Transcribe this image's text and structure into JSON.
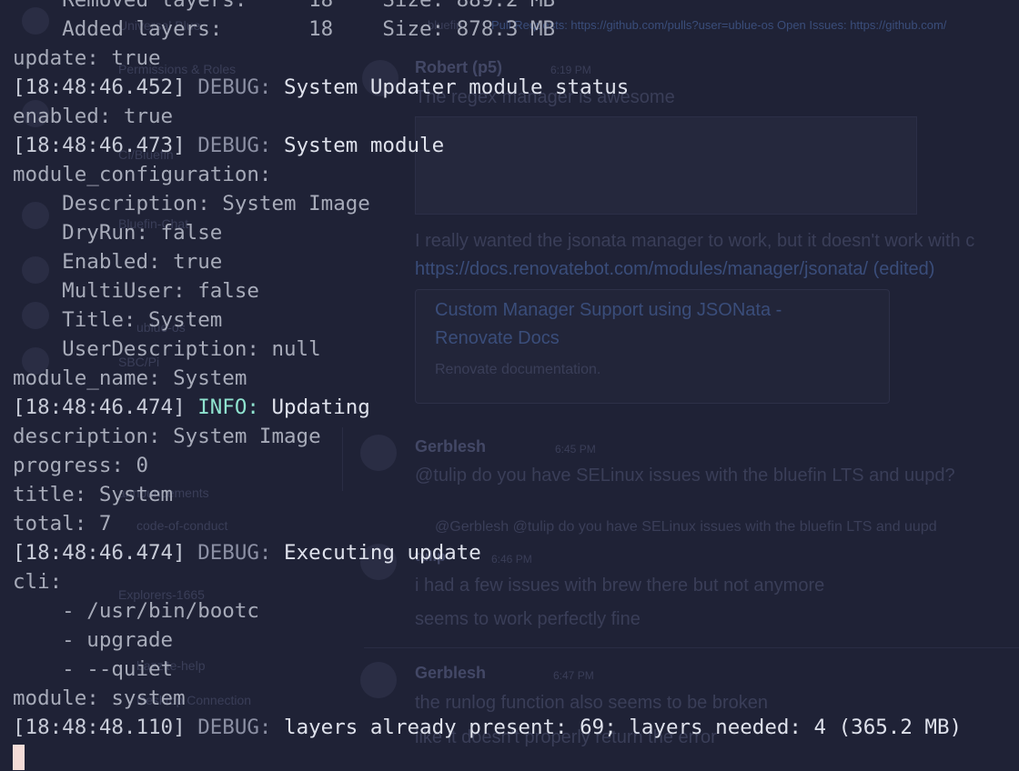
{
  "background_app": {
    "sidebar": {
      "items": [
        "Universal Blue",
        "Permissions & Roles",
        "CI/Bluefin",
        "Bluefin-Chat",
        "ublue-os",
        "SBC/Pi",
        "announcements",
        "code-of-conduct",
        "Explorers-1665",
        "bazzite-help",
        "Desktop Connection"
      ]
    },
    "header": {
      "channel": "bluefin",
      "links": "Pull Requests: https://github.com/pulls?user=ublue-os  Open Issues: https://github.com/"
    },
    "messages": [
      {
        "author": "Robert (p5)",
        "time": "6:19 PM",
        "text": "The regex manager is awesome"
      },
      {
        "author": "",
        "time": "",
        "text": "I really wanted the jsonata manager to work, but it doesn't work with c"
      },
      {
        "author": "",
        "time": "",
        "text": "https://docs.renovatebot.com/modules/manager/jsonata/ (edited)"
      },
      {
        "author": "Gerblesh",
        "time": "6:45 PM",
        "text": "@tulip do you have SELinux issues with the bluefin LTS and uupd?"
      },
      {
        "author": "",
        "time": "",
        "text": "@Gerblesh @tulip do you have SELinux issues with the bluefin LTS and uupd"
      },
      {
        "author": "tulip",
        "time": "6:46 PM",
        "text": "i had a few issues with brew there but not anymore"
      },
      {
        "author": "",
        "time": "",
        "text": "seems to work perfectly fine"
      },
      {
        "author": "Gerblesh",
        "time": "6:47 PM",
        "text": "the runlog function also seems to be broken"
      },
      {
        "author": "",
        "time": "",
        "text": "like it doesn't properly return the error"
      }
    ],
    "embed": {
      "title_line1": "Custom Manager Support using JSONata -",
      "title_line2": "Renovate Docs",
      "description": "Renovate documentation."
    }
  },
  "terminal": {
    "lines": [
      {
        "kind": "plain",
        "text": "    Removed layers:     18    Size: 889.2 MB"
      },
      {
        "kind": "plain",
        "text": "    Added layers:       18    Size: 878.3 MB"
      },
      {
        "kind": "plain",
        "text": "update: true"
      },
      {
        "kind": "log",
        "ts": "[18:48:46.452]",
        "level": "DEBUG:",
        "levelClass": "debug",
        "msg": "System Updater module status"
      },
      {
        "kind": "plain",
        "text": "enabled: true"
      },
      {
        "kind": "log",
        "ts": "[18:48:46.473]",
        "level": "DEBUG:",
        "levelClass": "debug",
        "msg": "System module"
      },
      {
        "kind": "plain",
        "text": "module_configuration:"
      },
      {
        "kind": "plain",
        "text": "    Description: System Image"
      },
      {
        "kind": "plain",
        "text": "    DryRun: false"
      },
      {
        "kind": "plain",
        "text": "    Enabled: true"
      },
      {
        "kind": "plain",
        "text": "    MultiUser: false"
      },
      {
        "kind": "plain",
        "text": "    Title: System"
      },
      {
        "kind": "plain",
        "text": "    UserDescription: null"
      },
      {
        "kind": "plain",
        "text": "module_name: System"
      },
      {
        "kind": "log",
        "ts": "[18:48:46.474]",
        "level": "INFO:",
        "levelClass": "info",
        "msg": "Updating"
      },
      {
        "kind": "plain",
        "text": "description: System Image"
      },
      {
        "kind": "plain",
        "text": "progress: 0"
      },
      {
        "kind": "plain",
        "text": "title: System"
      },
      {
        "kind": "plain",
        "text": "total: 7"
      },
      {
        "kind": "log",
        "ts": "[18:48:46.474]",
        "level": "DEBUG:",
        "levelClass": "debug",
        "msg": "Executing update"
      },
      {
        "kind": "plain",
        "text": "cli:"
      },
      {
        "kind": "plain",
        "text": "    - /usr/bin/bootc"
      },
      {
        "kind": "plain",
        "text": "    - upgrade"
      },
      {
        "kind": "plain",
        "text": "    - --quiet"
      },
      {
        "kind": "plain",
        "text": "module: system"
      },
      {
        "kind": "log",
        "ts": "[18:48:48.110]",
        "level": "DEBUG:",
        "levelClass": "debug",
        "msg": "layers already present: 69; layers needed: 4 (365.2 MB)"
      }
    ]
  },
  "colors": {
    "background": "#1f2236",
    "info": "#8fe3cf",
    "cursor": "#f4dcd8"
  }
}
